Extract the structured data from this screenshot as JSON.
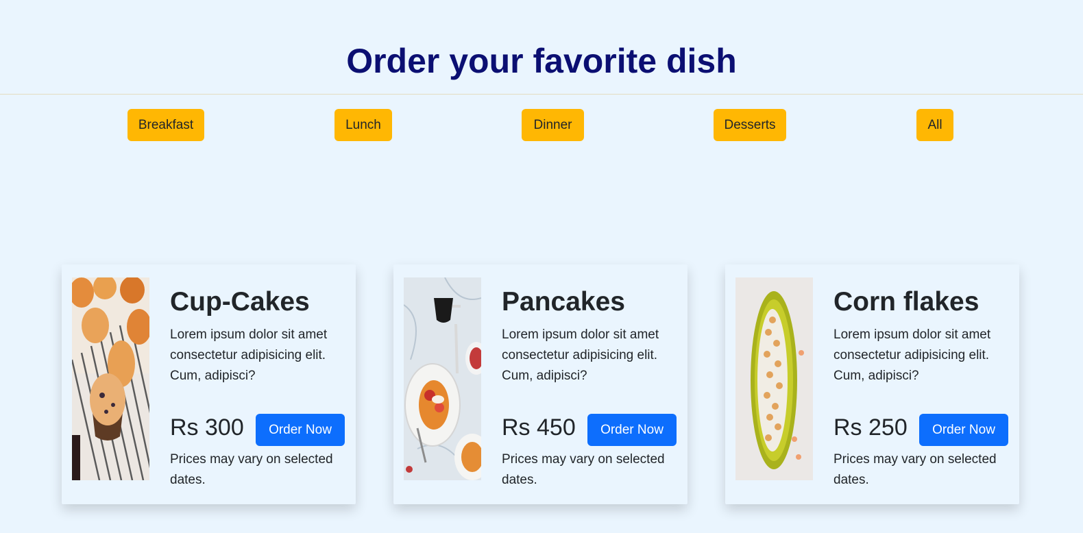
{
  "header": {
    "title": "Order your favorite dish"
  },
  "filters": [
    {
      "label": "Breakfast"
    },
    {
      "label": "Lunch"
    },
    {
      "label": "Dinner"
    },
    {
      "label": "Desserts"
    },
    {
      "label": "All"
    }
  ],
  "cards": [
    {
      "title": "Cup-Cakes",
      "description": "Lorem ipsum dolor sit amet consectetur adipisicing elit. Cum, adipisci?",
      "price": "Rs 300",
      "order_label": "Order Now",
      "note": "Prices may vary on selected dates.",
      "image_icon": "cupcakes-photo"
    },
    {
      "title": "Pancakes",
      "description": "Lorem ipsum dolor sit amet consectetur adipisicing elit. Cum, adipisci?",
      "price": "Rs 450",
      "order_label": "Order Now",
      "note": "Prices may vary on selected dates.",
      "image_icon": "pancakes-photo"
    },
    {
      "title": "Corn flakes",
      "description": "Lorem ipsum dolor sit amet consectetur adipisicing elit. Cum, adipisci?",
      "price": "Rs 250",
      "order_label": "Order Now",
      "note": "Prices may vary on selected dates.",
      "image_icon": "cornflakes-photo"
    }
  ],
  "colors": {
    "background": "#eaf5fe",
    "title": "#0b0f72",
    "filter_button": "#ffb703",
    "order_button": "#0d6efd"
  }
}
